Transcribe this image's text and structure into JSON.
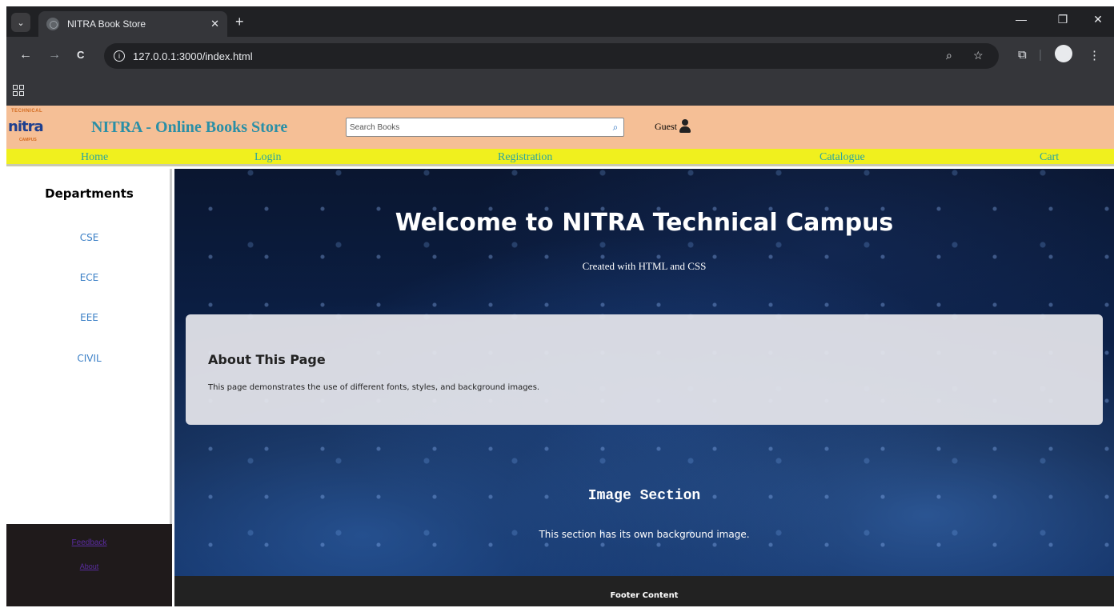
{
  "browser": {
    "tab_title": "NITRA Book Store",
    "tab_close": "✕",
    "new_tab": "+",
    "url": "127.0.0.1:3000/index.html",
    "icons": {
      "tab_menu": "chevron-down-icon",
      "back": "←",
      "forward": "→",
      "reload": "C",
      "zoom": "⌕",
      "star": "☆",
      "extensions": "⧉",
      "minimize": "—",
      "restore": "❐",
      "close": "✕",
      "menu": "⋮"
    }
  },
  "header": {
    "logo_top": "TECHNICAL",
    "logo_word": "nitra",
    "logo_bottom": "CAMPUS",
    "site_title": "NITRA - Online Books Store",
    "search_placeholder": "Search Books",
    "search_icon": "🔍",
    "user_label": "Guest"
  },
  "nav": {
    "items": [
      "Home",
      "Login",
      "Registration",
      "Catalogue",
      "Cart"
    ]
  },
  "sidebar": {
    "title": "Departments",
    "items": [
      "CSE",
      "ECE",
      "EEE",
      "CIVIL"
    ],
    "footer_links": [
      "Feedback",
      "About"
    ]
  },
  "main": {
    "hero_title": "Welcome to NITRA Technical Campus",
    "hero_subtitle": "Created with HTML and CSS",
    "about_title": "About This Page",
    "about_text": "This page demonstrates the use of different fonts, styles, and background images.",
    "image_title": "Image Section",
    "image_text": "This section has its own background image."
  },
  "footer": {
    "text": "Footer Content"
  },
  "colors": {
    "header_bg": "#f5bf96",
    "nav_bg": "#f0f01e",
    "nav_link": "#2aa5a0",
    "site_title": "#2a8fa6",
    "dept_link": "#3a7fc6",
    "footer_bg": "#222222"
  }
}
